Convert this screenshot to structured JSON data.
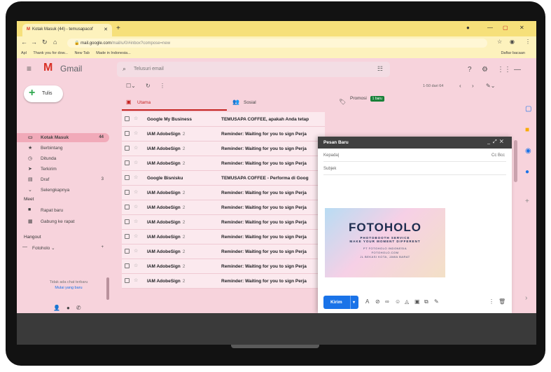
{
  "browser": {
    "tab_title": "Kotak Masuk (44) - temusapacof",
    "tab_favicon": "M",
    "url_host": "mail.google.com",
    "url_path": "/mail/u/0/#inbox?compose=new",
    "bookmarks": [
      "Apl",
      "Thank you for dow...",
      "New Tab",
      "Made in Indonesia..."
    ],
    "bookmarks_right": "Daftar bacaan"
  },
  "gmail": {
    "logo_text": "Gmail",
    "search_placeholder": "Telusuri email",
    "compose_label": "Tulis",
    "nav": [
      {
        "label": "Kotak Masuk",
        "count": "44",
        "icon": "inbox-icon"
      },
      {
        "label": "Berbintang",
        "count": "",
        "icon": "star-icon"
      },
      {
        "label": "Ditunda",
        "count": "",
        "icon": "clock-icon"
      },
      {
        "label": "Terkirim",
        "count": "",
        "icon": "send-icon"
      },
      {
        "label": "Draf",
        "count": "3",
        "icon": "draft-icon"
      },
      {
        "label": "Selengkapnya",
        "count": "",
        "icon": "chevron-down-icon"
      }
    ],
    "meet_title": "Meet",
    "meet_items": [
      "Rapat baru",
      "Gabung ke rapat"
    ],
    "hangout_title": "Hangout",
    "hangout_user": "Fotoholo",
    "hangout_empty": "Tidak ada chat terbaru",
    "hangout_link": "Mulai yang baru",
    "pager": "1-50 dari 64",
    "tabs": [
      {
        "label": "Utama"
      },
      {
        "label": "Sosial"
      },
      {
        "label": "Promosi",
        "badge": "1 baru"
      }
    ],
    "emails": [
      {
        "sender": "Google My Business",
        "count": "",
        "subject": "TEMUSAPA COFFEE, apakah Anda tetap"
      },
      {
        "sender": "IAM AdobeSign",
        "count": "2",
        "subject": "Reminder: Waiting for you to sign Perja"
      },
      {
        "sender": "IAM AdobeSign",
        "count": "2",
        "subject": "Reminder: Waiting for you to sign Perja"
      },
      {
        "sender": "IAM AdobeSign",
        "count": "2",
        "subject": "Reminder: Waiting for you to sign Perja"
      },
      {
        "sender": "Google Bisnisku",
        "count": "",
        "subject": "TEMUSAPA COFFEE - Performa di Goog"
      },
      {
        "sender": "IAM AdobeSign",
        "count": "2",
        "subject": "Reminder: Waiting for you to sign Perja"
      },
      {
        "sender": "IAM AdobeSign",
        "count": "2",
        "subject": "Reminder: Waiting for you to sign Perja"
      },
      {
        "sender": "IAM AdobeSign",
        "count": "2",
        "subject": "Reminder: Waiting for you to sign Perja"
      },
      {
        "sender": "IAM AdobeSign",
        "count": "2",
        "subject": "Reminder: Waiting for you to sign Perja"
      },
      {
        "sender": "IAM AdobeSign",
        "count": "2",
        "subject": "Reminder: Waiting for you to sign Perja"
      },
      {
        "sender": "IAM AdobeSign",
        "count": "2",
        "subject": "Reminder: Waiting for you to sign Perja"
      },
      {
        "sender": "IAM AdobeSign",
        "count": "2",
        "subject": "Reminder: Waiting for you to sign Perja"
      }
    ]
  },
  "compose": {
    "title": "Pesan Baru",
    "to_placeholder": "Kepada",
    "cc_bcc": "Cc Bcc",
    "subject_placeholder": "Subjek",
    "send_label": "Kirim",
    "banner_logo": "FOTOHOLO",
    "banner_tag1": "PHOTOBOOTH SERVICE",
    "banner_tag2": "MAKE YOUR MOMENT DIFFERENT",
    "banner_addr1": "PT FOTOHOLO INDONESIA",
    "banner_addr2": "FOTOHOLO.COM",
    "banner_addr3": "JL BEKASI KOTA, JAWA BARAT"
  },
  "colors": {
    "screen_bg": "#f7d3dc",
    "chrome_tab": "#f6e07a",
    "accent_red": "#c5221f",
    "send_blue": "#1a73e8"
  }
}
